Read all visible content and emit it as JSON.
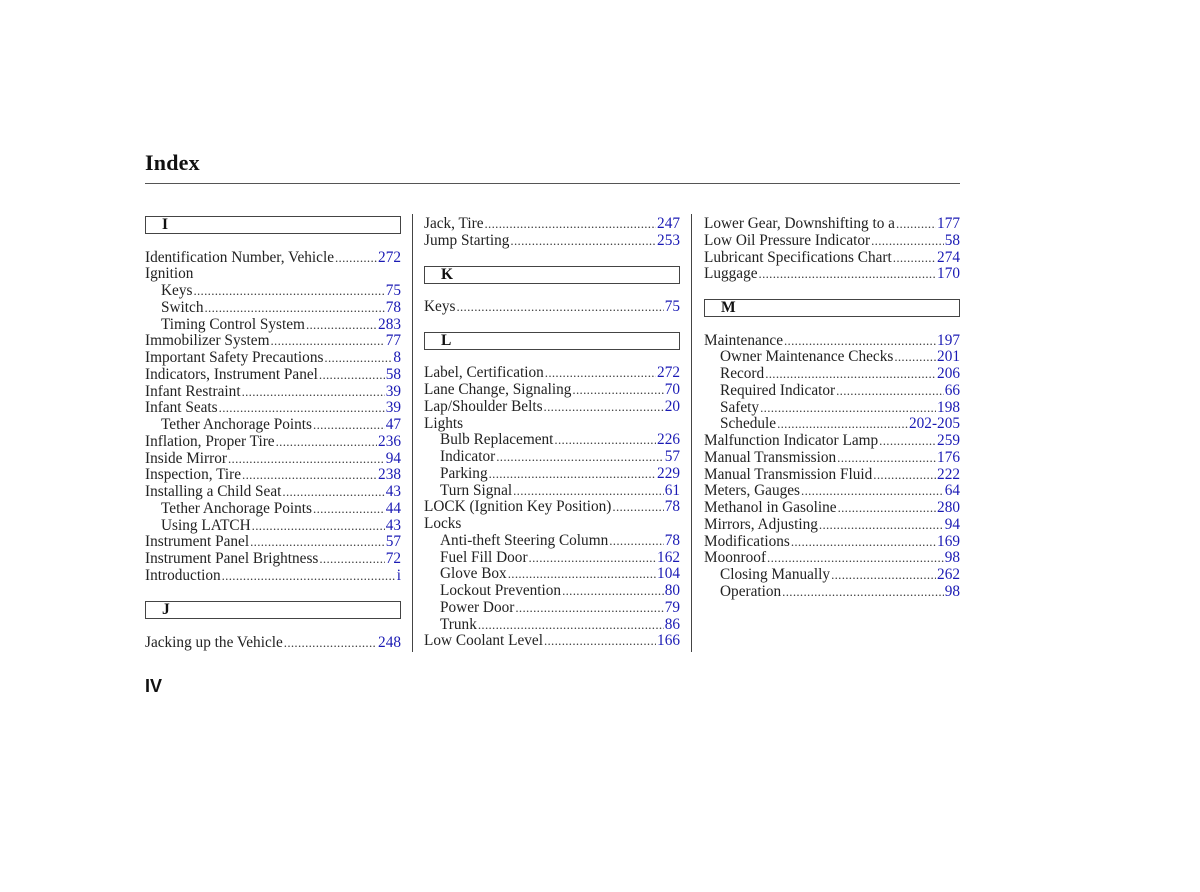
{
  "page": {
    "title": "Index",
    "page_number": "IV",
    "link_color": "#1a1ab4"
  },
  "columns": [
    {
      "blocks": [
        {
          "type": "letter",
          "label": "I"
        },
        {
          "type": "entry",
          "text": "Identification Number, Vehicle",
          "page": "272"
        },
        {
          "type": "head",
          "text": "Ignition"
        },
        {
          "type": "sub",
          "text": "Keys",
          "page": "75"
        },
        {
          "type": "sub",
          "text": "Switch",
          "page": "78"
        },
        {
          "type": "sub",
          "text": "Timing Control System",
          "page": "283"
        },
        {
          "type": "entry",
          "text": "Immobilizer System",
          "page": "77"
        },
        {
          "type": "entry",
          "text": "Important Safety Precautions",
          "page": "8"
        },
        {
          "type": "entry",
          "text": "Indicators, Instrument Panel",
          "page": "58"
        },
        {
          "type": "entry",
          "text": "Infant Restraint",
          "page": "39"
        },
        {
          "type": "entry",
          "text": "Infant Seats",
          "page": "39"
        },
        {
          "type": "sub",
          "text": "Tether Anchorage Points",
          "page": "47"
        },
        {
          "type": "entry",
          "text": "Inflation, Proper Tire",
          "page": "236"
        },
        {
          "type": "entry",
          "text": "Inside Mirror",
          "page": "94"
        },
        {
          "type": "entry",
          "text": "Inspection, Tire",
          "page": "238"
        },
        {
          "type": "entry",
          "text": "Installing a Child Seat",
          "page": "43"
        },
        {
          "type": "sub",
          "text": "Tether Anchorage Points",
          "page": "44"
        },
        {
          "type": "sub",
          "text": "Using LATCH",
          "page": "43"
        },
        {
          "type": "entry",
          "text": "Instrument Panel",
          "page": "57"
        },
        {
          "type": "entry",
          "text": "Instrument Panel Brightness",
          "page": "72"
        },
        {
          "type": "entry",
          "text": "Introduction",
          "page": "i"
        },
        {
          "type": "gap"
        },
        {
          "type": "letter",
          "label": "J"
        },
        {
          "type": "entry",
          "text": "Jacking up the Vehicle",
          "page": "248"
        }
      ]
    },
    {
      "blocks": [
        {
          "type": "entry",
          "text": "Jack, Tire",
          "page": "247"
        },
        {
          "type": "entry",
          "text": "Jump Starting",
          "page": "253"
        },
        {
          "type": "gap-sm"
        },
        {
          "type": "letter",
          "label": "K"
        },
        {
          "type": "entry",
          "text": "Keys",
          "page": "75"
        },
        {
          "type": "gap-sm"
        },
        {
          "type": "letter",
          "label": "L"
        },
        {
          "type": "entry",
          "text": "Label, Certification",
          "page": "272"
        },
        {
          "type": "entry",
          "text": "Lane Change, Signaling",
          "page": "70"
        },
        {
          "type": "entry",
          "text": "Lap/Shoulder Belts",
          "page": "20"
        },
        {
          "type": "head",
          "text": "Lights"
        },
        {
          "type": "sub",
          "text": "Bulb Replacement",
          "page": "226"
        },
        {
          "type": "sub",
          "text": "Indicator",
          "page": "57"
        },
        {
          "type": "sub",
          "text": "Parking",
          "page": "229"
        },
        {
          "type": "sub",
          "text": "Turn Signal",
          "page": "61"
        },
        {
          "type": "entry",
          "text": "LOCK (Ignition Key Position)",
          "page": "78"
        },
        {
          "type": "head",
          "text": "Locks"
        },
        {
          "type": "sub",
          "text": "Anti-theft Steering Column",
          "page": "78"
        },
        {
          "type": "sub",
          "text": "Fuel Fill Door",
          "page": "162"
        },
        {
          "type": "sub",
          "text": "Glove Box",
          "page": "104"
        },
        {
          "type": "sub",
          "text": "Lockout Prevention",
          "page": "80"
        },
        {
          "type": "sub",
          "text": "Power Door",
          "page": "79"
        },
        {
          "type": "sub",
          "text": "Trunk",
          "page": "86"
        },
        {
          "type": "entry",
          "text": "Low Coolant Level",
          "page": "166"
        }
      ]
    },
    {
      "blocks": [
        {
          "type": "entry",
          "text": "Lower Gear, Downshifting to a",
          "page": "177"
        },
        {
          "type": "entry",
          "text": "Low Oil Pressure Indicator",
          "page": "58"
        },
        {
          "type": "entry",
          "text": "Lubricant Specifications Chart",
          "page": "274"
        },
        {
          "type": "entry",
          "text": "Luggage",
          "page": "170"
        },
        {
          "type": "gap-sm"
        },
        {
          "type": "letter",
          "label": "M"
        },
        {
          "type": "entry",
          "text": "Maintenance",
          "page": "197"
        },
        {
          "type": "sub",
          "text": "Owner Maintenance Checks",
          "page": "201"
        },
        {
          "type": "sub",
          "text": "Record",
          "page": "206"
        },
        {
          "type": "sub",
          "text": "Required Indicator",
          "page": "66"
        },
        {
          "type": "sub",
          "text": "Safety",
          "page": "198"
        },
        {
          "type": "sub",
          "text": "Schedule",
          "page": "202-205"
        },
        {
          "type": "entry",
          "text": "Malfunction Indicator Lamp",
          "page": "259"
        },
        {
          "type": "entry",
          "text": "Manual Transmission",
          "page": "176"
        },
        {
          "type": "entry",
          "text": "Manual Transmission Fluid",
          "page": "222"
        },
        {
          "type": "entry",
          "text": "Meters, Gauges",
          "page": "64"
        },
        {
          "type": "entry",
          "text": "Methanol in Gasoline",
          "page": "280"
        },
        {
          "type": "entry",
          "text": "Mirrors, Adjusting",
          "page": "94"
        },
        {
          "type": "entry",
          "text": "Modifications",
          "page": "169"
        },
        {
          "type": "entry",
          "text": "Moonroof",
          "page": "98"
        },
        {
          "type": "sub",
          "text": "Closing Manually",
          "page": "262"
        },
        {
          "type": "sub",
          "text": "Operation",
          "page": "98"
        }
      ]
    }
  ]
}
